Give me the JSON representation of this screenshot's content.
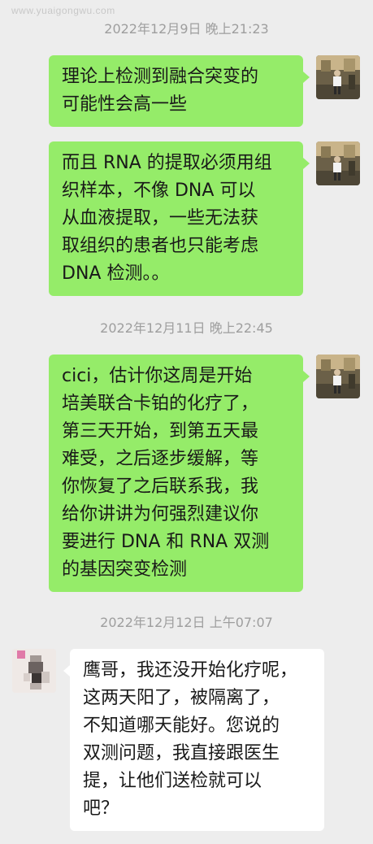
{
  "watermark": "www.yuaigongwu.com",
  "messages": [
    {
      "timestamp": "2022年12月9日 晚上21:23"
    },
    {
      "side": "mine",
      "lines": [
        "理论上检测到融合突变的",
        "可能性会高一些"
      ]
    },
    {
      "side": "mine",
      "lines": [
        "而且 RNA 的提取必须用组",
        "织样本，不像 DNA 可以",
        "从血液提取，一些无法获",
        "取组织的患者也只能考虑",
        "DNA 检测。。"
      ]
    },
    {
      "timestamp": "2022年12月11日 晚上22:45"
    },
    {
      "side": "mine",
      "lines": [
        "cici，估计你这周是开始",
        "培美联合卡铂的化疗了，",
        "第三天开始，到第五天最",
        "难受，之后逐步缓解，等",
        "你恢复了之后联系我，我",
        "给你讲讲为何强烈建议你",
        "要进行 DNA 和 RNA 双测",
        "的基因突变检测"
      ]
    },
    {
      "timestamp": "2022年12月12日 上午07:07"
    },
    {
      "side": "theirs",
      "lines": [
        "鹰哥，我还没开始化疗呢，",
        "这两天阳了，被隔离了，",
        "不知道哪天能好。您说的",
        "双测问题，我直接跟医生",
        "提，让他们送检就可以",
        "吧？"
      ]
    }
  ],
  "colors": {
    "background": "#ededed",
    "mine_bubble": "#95ec69",
    "theirs_bubble": "#ffffff",
    "timestamp_text": "#9e9e9e"
  },
  "icons": {
    "my_avatar": "photo-avatar",
    "their_avatar": "blurred-avatar"
  }
}
